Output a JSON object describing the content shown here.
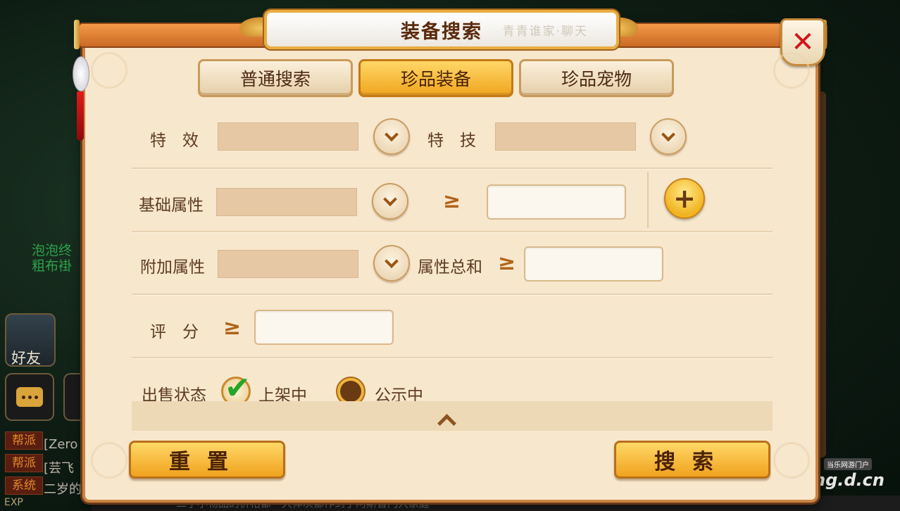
{
  "dialog": {
    "title": "装备搜索",
    "title_deco": "青青谁家·聊天"
  },
  "tabs": [
    {
      "label": "普通搜索",
      "active": false
    },
    {
      "label": "珍品装备",
      "active": true
    },
    {
      "label": "珍品宠物",
      "active": false
    }
  ],
  "filters": {
    "effect_label": "特　效",
    "skill_label": "特　技",
    "base_attr_label": "基础属性",
    "extra_attr_label": "附加属性",
    "attr_sum_label": "属性总和",
    "score_label": "评　分",
    "gte_symbol": "≥",
    "sale_status_label": "出售状态",
    "listed_label": "上架中",
    "listed_checked": true,
    "public_label": "公示中",
    "public_checked": false
  },
  "buttons": {
    "reset": "重置",
    "search": "搜索"
  },
  "background": {
    "chat_name_line1": "泡泡终",
    "chat_name_line2": "粗布褂",
    "friend_label": "好友",
    "tags": [
      "帮派",
      "帮派",
      "系统"
    ],
    "tag_texts": [
      "[Zero",
      "[芸飞",
      "二岁的"
    ],
    "exp_label": "EXP",
    "bottom_text": "二手小物品的价格都一大体次都作到了阿斯普门大家庭",
    "watermark": "ng.d.cn",
    "watermark_small": "当乐网游门户"
  },
  "colors": {
    "accent_gold": "#f0a51f",
    "panel_bg": "#f7e7cd",
    "border_orange": "#c98342",
    "close_red": "#d2161c",
    "check_green": "#27a528"
  }
}
